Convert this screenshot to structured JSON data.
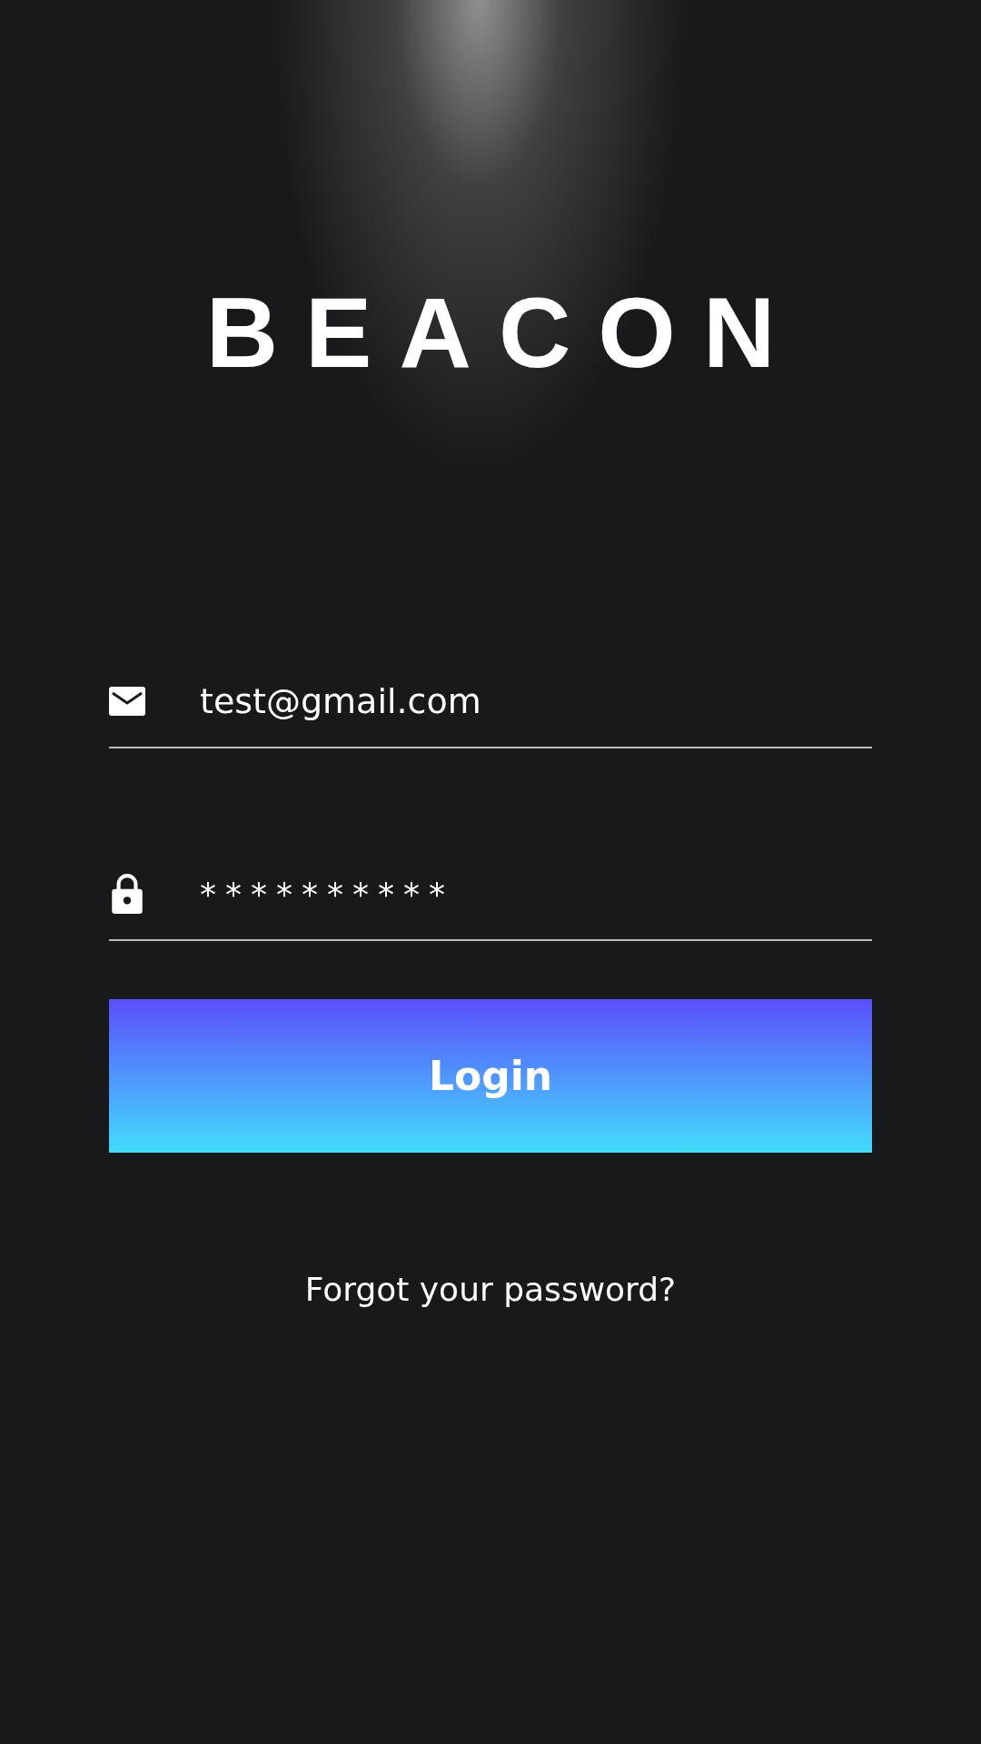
{
  "logo": "BEACON",
  "fields": [
    {
      "kind": "email",
      "value": "test@gmail.com"
    },
    {
      "kind": "password",
      "value": "**********"
    }
  ],
  "login_button": "Login",
  "forgot_link": "Forgot your password?"
}
